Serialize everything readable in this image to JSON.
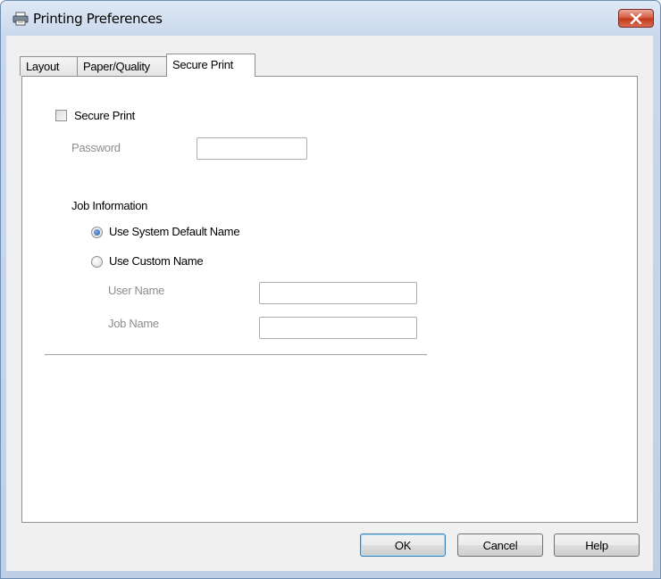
{
  "window": {
    "title": "Printing Preferences",
    "close_icon": "close-icon"
  },
  "tabs": [
    {
      "label": "Layout"
    },
    {
      "label": "Paper/Quality"
    },
    {
      "label": "Secure Print"
    }
  ],
  "secure_print": {
    "checkbox_label": "Secure Print",
    "checked": false,
    "password_label": "Password",
    "password_value": ""
  },
  "job_information": {
    "heading": "Job Information",
    "option_default": "Use System Default Name",
    "option_custom": "Use Custom Name",
    "selected": "default",
    "user_name_label": "User Name",
    "user_name_value": "",
    "job_name_label": "Job Name",
    "job_name_value": ""
  },
  "buttons": {
    "ok": "OK",
    "cancel": "Cancel",
    "help": "Help"
  },
  "colors": {
    "close_button": "#c9432a",
    "dim_text": "#8d8d8d",
    "accent": "#1c5aa8"
  }
}
